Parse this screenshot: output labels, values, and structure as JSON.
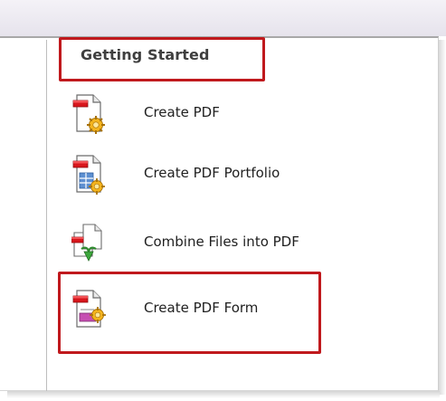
{
  "panel": {
    "heading": "Getting Started",
    "items": [
      {
        "label": "Create PDF",
        "icon": "create-pdf-icon"
      },
      {
        "label": "Create PDF Portfolio",
        "icon": "create-pdf-portfolio-icon"
      },
      {
        "label": "Combine Files into PDF",
        "icon": "combine-files-icon"
      },
      {
        "label": "Create PDF Form",
        "icon": "create-pdf-form-icon"
      }
    ]
  },
  "colors": {
    "highlight": "#c0191d",
    "heading_text": "#3f3f3f",
    "item_text": "#1f1f1f"
  }
}
